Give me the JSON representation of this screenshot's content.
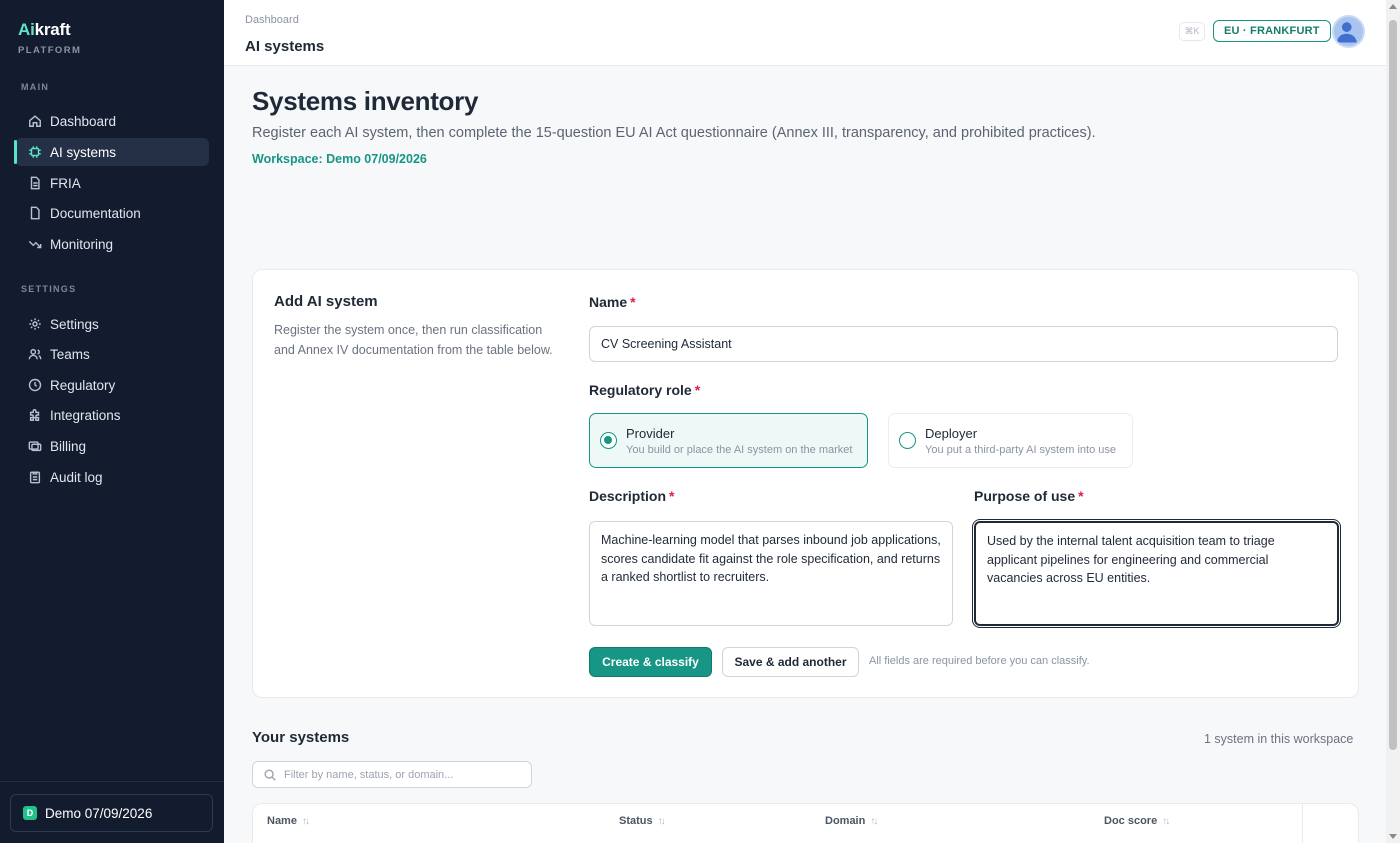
{
  "brand": {
    "name_prefix": "Ai",
    "name_suffix": "kraft",
    "subtitle": "PLATFORM"
  },
  "sidebar": {
    "main_section": "MAIN",
    "settings_section": "SETTINGS",
    "main_items": [
      {
        "label": "Dashboard",
        "icon": "home-icon"
      },
      {
        "label": "AI systems",
        "icon": "chip-icon",
        "active": true
      },
      {
        "label": "FRIA",
        "icon": "file-icon"
      },
      {
        "label": "Documentation",
        "icon": "document-icon"
      },
      {
        "label": "Monitoring",
        "icon": "trend-down-icon"
      }
    ],
    "settings_items": [
      {
        "label": "Settings",
        "icon": "gear-icon"
      },
      {
        "label": "Teams",
        "icon": "users-icon"
      },
      {
        "label": "Regulatory",
        "icon": "clock-icon"
      },
      {
        "label": "Integrations",
        "icon": "puzzle-icon"
      },
      {
        "label": "Billing",
        "icon": "billing-icon"
      },
      {
        "label": "Audit log",
        "icon": "clipboard-icon"
      }
    ],
    "workspace": {
      "badge": "D",
      "name": "Demo 07/09/2026"
    }
  },
  "topbar": {
    "breadcrumb": "Dashboard",
    "title": "AI systems",
    "shortcut": "⌘K",
    "region": "EU · FRANKFURT"
  },
  "main": {
    "title": "Systems inventory",
    "subtitle": "Register each AI system, then complete the 15-question EU AI Act questionnaire (Annex III, transparency, and prohibited practices).",
    "workspace_label": "Workspace: Demo 07/09/2026"
  },
  "form": {
    "title": "Add AI system",
    "description": "Register the system once, then run classification and Annex IV documentation from the table below.",
    "name_label": "Name",
    "name_value": "CV Screening Assistant",
    "role_label": "Regulatory role",
    "roles": [
      {
        "title": "Provider",
        "desc": "You build or place the AI system on the market",
        "selected": true
      },
      {
        "title": "Deployer",
        "desc": "You put a third-party AI system into use",
        "selected": false
      }
    ],
    "description_label": "Description",
    "description_value": "Machine-learning model that parses inbound job applications, scores candidate fit against the role specification, and returns a ranked shortlist to recruiters.",
    "purpose_label": "Purpose of use",
    "purpose_value": "Used by the internal talent acquisition team to triage applicant pipelines for engineering and commercial vacancies across EU entities.",
    "required_mark": "*",
    "primary_button": "Create & classify",
    "secondary_button": "Save & add another",
    "hint": "All fields are required before you can classify."
  },
  "systems": {
    "title": "Your systems",
    "count": "1 system in this workspace",
    "filter_placeholder": "Filter by name, status, or domain...",
    "columns": [
      "Name",
      "Status",
      "Domain",
      "Doc score"
    ]
  },
  "colors": {
    "accent": "#179685",
    "sidebar_bg": "#131c2e",
    "highlight": "#5fe3c6",
    "required": "#e11d48"
  }
}
